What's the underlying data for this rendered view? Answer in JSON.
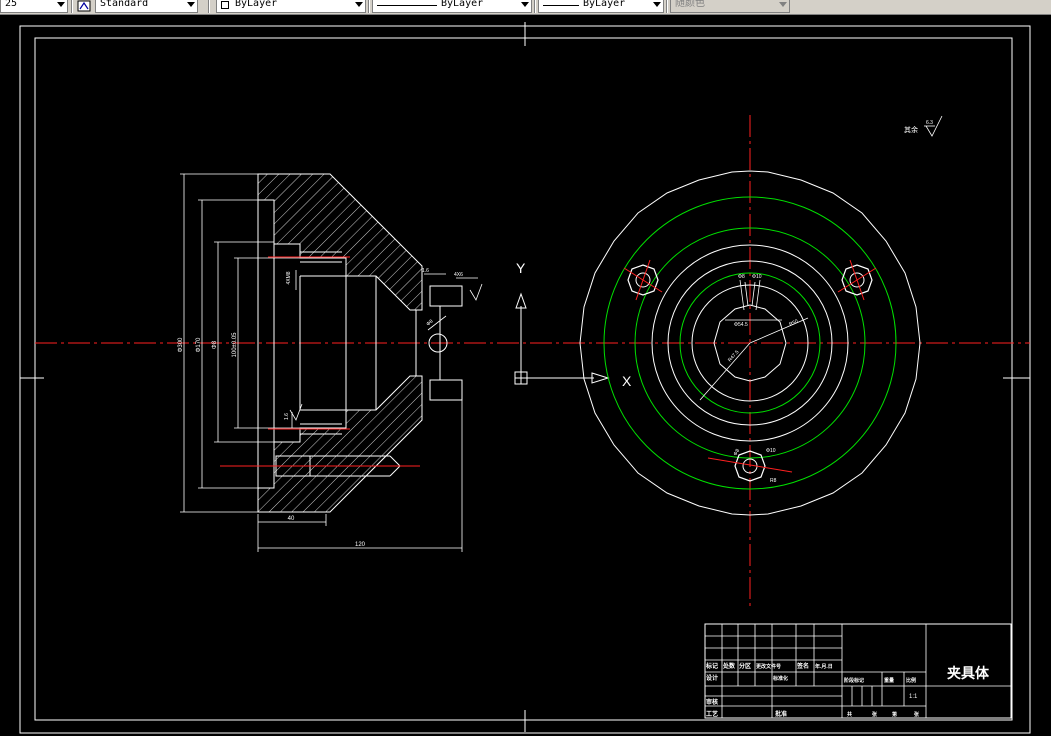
{
  "toolbar": {
    "dimstyle_value": "25",
    "textstyle_value": "Standard",
    "layer_value": "ByLayer",
    "linetype_value": "ByLayer",
    "lineweight_value": "ByLayer",
    "color_value": "随颜色"
  },
  "drawing": {
    "dims": {
      "d1": "Φ300",
      "d2": "Φ170",
      "d3": "Φ8",
      "d4": "100±0.05",
      "len40": "40",
      "len120": "120",
      "m8": "4XM8",
      "small1": "1.6",
      "small2": "4X6",
      "small3": "1.6",
      "r_small": "Φ8",
      "bolt1": "Φ8",
      "bolt2": "Φ10",
      "pcd": "Φ54.5",
      "r_inner": "R50",
      "r_mid": "R47.5",
      "bottom1": "Φ8",
      "bottom2": "Φ10",
      "bottom3": "R8"
    },
    "axis_y": "Y",
    "axis_x": "X",
    "roughness_text": "其余",
    "roughness_val": "6.3",
    "title_block": {
      "part_name": "夹具体",
      "scale": "1:1",
      "row_labels": [
        "标记",
        "处数",
        "分区",
        "更改文件号",
        "签名",
        "年.月.日"
      ],
      "left_labels": [
        "设计",
        "审核",
        "工艺"
      ],
      "mid_labels": [
        "标准化",
        "批准"
      ],
      "right_headers": [
        "阶段标记",
        "重量",
        "比例"
      ],
      "sheet_labels": [
        "共",
        "张",
        "第",
        "张"
      ]
    }
  }
}
